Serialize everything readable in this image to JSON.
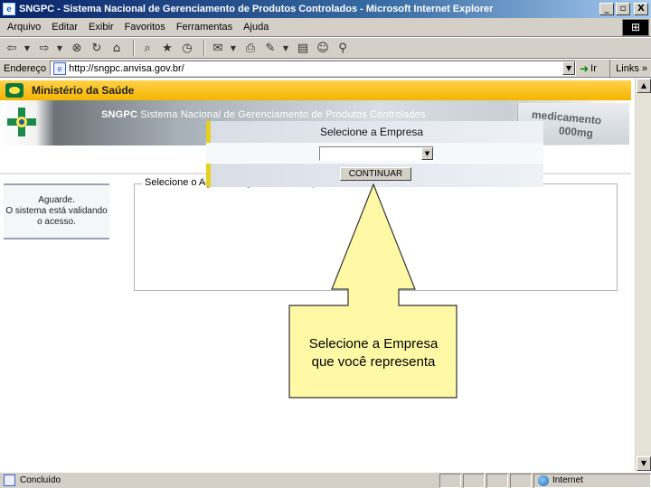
{
  "window": {
    "title": "SNGPC - Sistema Nacional de Gerenciamento de Produtos Controlados - Microsoft Internet Explorer",
    "minimize_label": "_",
    "maximize_label": "▫",
    "close_label": "X"
  },
  "menu": {
    "items": [
      "Arquivo",
      "Editar",
      "Exibir",
      "Favoritos",
      "Ferramentas",
      "Ajuda"
    ]
  },
  "address_bar": {
    "label": "Endereço",
    "url": "http://sngpc.anvisa.gov.br/",
    "go_label": "Ir",
    "links_label": "Links »"
  },
  "page": {
    "ministry_label": "Ministério da Saúde",
    "system_prefix": "SNGPC",
    "system_title": "Sistema Nacional de Gerenciamento de Produtos Controlados",
    "banner_text_1": "medicamento",
    "banner_text_2": "000mg",
    "status_panel": {
      "line1": "Aguarde.",
      "line2": "O sistema está validando",
      "line3": "o acesso."
    },
    "fieldset_legend": "Selecione o Agente Regulado a ser representado",
    "select_header": "Selecione a Empresa",
    "select_value": "",
    "continue_button": "CONTINUAR"
  },
  "callout": {
    "line1": "Selecione a Empresa",
    "line2": "que você representa"
  },
  "statusbar": {
    "status_text": "Concluído",
    "zone_text": "Internet"
  },
  "colors": {
    "title_bar": "#0a246a",
    "chrome": "#d4d0c8",
    "header_yellow": "#f5b400",
    "callout_fill": "#fff9a6",
    "accent_stripe": "#e5cf1f"
  }
}
